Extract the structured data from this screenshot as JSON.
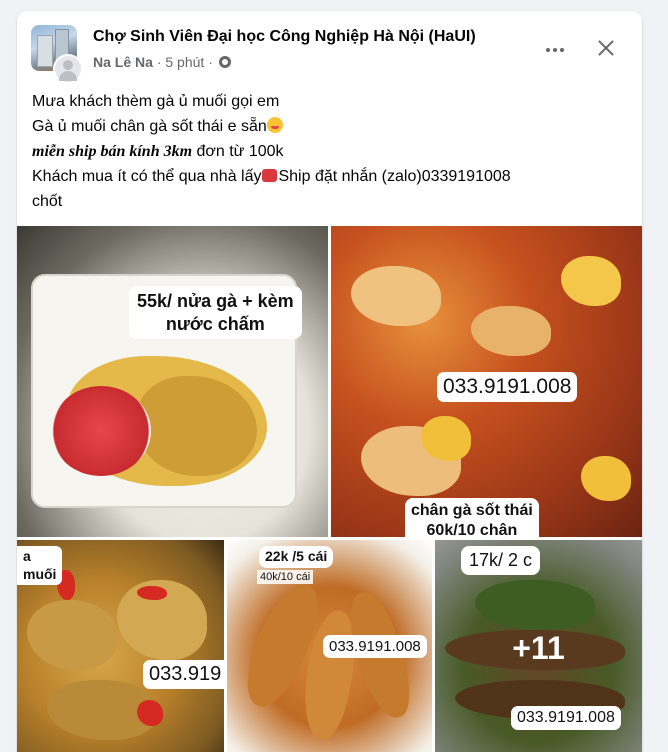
{
  "post": {
    "group_name": "Chợ Sinh Viên Đại học Công Nghiệp Hà Nội (HaUI)",
    "author": "Na Lê Na",
    "time": "5 phút",
    "separator": "·",
    "icons": {
      "group_avatar": "group-avatar",
      "user_avatar": "user-avatar",
      "privacy": "globe-icon",
      "more": "more-options-icon",
      "close": "close-icon"
    },
    "text": {
      "line1": "Mưa khách thèm gà ủ muối gọi em",
      "line2": " Gà ủ muối chân gà sốt thái e sẵn",
      "line3_bold": " miễn ship bán kính 3km",
      "line3_rest": " đơn từ 100k",
      "line4_a": "Khách mua ít có thể qua nhà lấy",
      "line4_b": "Ship đặt nhắn (zalo)0339191008",
      "line5": "chốt"
    }
  },
  "photos": [
    {
      "caption_line1": "55k/ nửa gà + kèm",
      "caption_line2": "nước chấm"
    },
    {
      "phone": "033.9191.008",
      "caption_line1": "chân gà sốt thái",
      "caption_line2": "60k/10 chân"
    },
    {
      "caption_line1": "a",
      "caption_line2": "muối",
      "phone": "033.919"
    },
    {
      "caption_line1": "22k /5 cái",
      "caption_line2": "40k/10 cái",
      "phone": "033.9191.008"
    },
    {
      "caption": "17k/ 2 c",
      "phone": "033.9191.008",
      "more_count": "+11"
    }
  ]
}
